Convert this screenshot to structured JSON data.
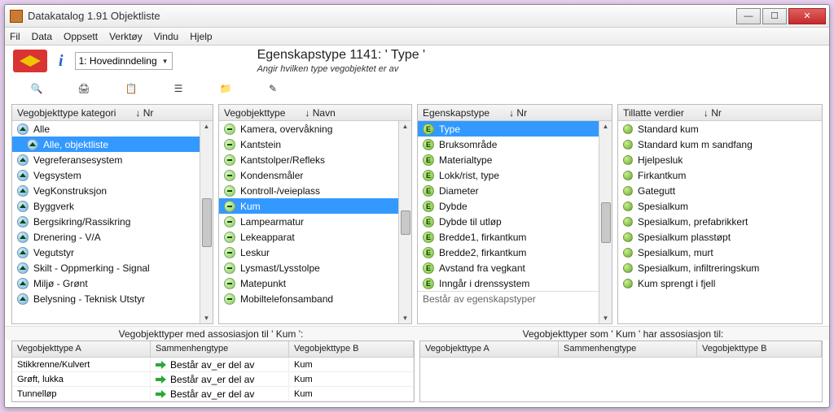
{
  "window": {
    "title": "Datakatalog 1.91  Objektliste"
  },
  "menubar": [
    "Fil",
    "Data",
    "Oppsett",
    "Verktøy",
    "Vindu",
    "Hjelp"
  ],
  "toolbar": {
    "combo_value": "1: Hovedinndeling",
    "title_big": "Egenskapstype 1141:  ' Type '",
    "title_small": "Angir hvilken type vegobjektet er av"
  },
  "panel1": {
    "header_label": "Vegobjekttype kategori",
    "header_sort": "↓ Nr",
    "items": [
      {
        "label": "Alle",
        "icon": "up",
        "selected": false
      },
      {
        "label": "Alle, objektliste",
        "icon": "up",
        "selected": true,
        "indent": true
      },
      {
        "label": "Vegreferansesystem",
        "icon": "up"
      },
      {
        "label": "Vegsystem",
        "icon": "up"
      },
      {
        "label": "VegKonstruksjon",
        "icon": "up"
      },
      {
        "label": "Byggverk",
        "icon": "up"
      },
      {
        "label": "Bergsikring/Rassikring",
        "icon": "up"
      },
      {
        "label": "Drenering - V/A",
        "icon": "up"
      },
      {
        "label": "Vegutstyr",
        "icon": "up"
      },
      {
        "label": "Skilt - Oppmerking - Signal",
        "icon": "up"
      },
      {
        "label": "Miljø - Grønt",
        "icon": "up"
      },
      {
        "label": "Belysning - Teknisk Utstyr",
        "icon": "up"
      }
    ]
  },
  "panel2": {
    "header_label": "Vegobjekttype",
    "header_sort": "↓ Navn",
    "items": [
      {
        "label": "Kamera, overvåkning",
        "icon": "minus"
      },
      {
        "label": "Kantstein",
        "icon": "minus"
      },
      {
        "label": "Kantstolper/Refleks",
        "icon": "minus"
      },
      {
        "label": "Kondensmåler",
        "icon": "minus"
      },
      {
        "label": "Kontroll-/veieplass",
        "icon": "minus"
      },
      {
        "label": "Kum",
        "icon": "minus",
        "selected": true
      },
      {
        "label": "Lampearmatur",
        "icon": "minus"
      },
      {
        "label": "Lekeapparat",
        "icon": "minus"
      },
      {
        "label": "Leskur",
        "icon": "minus"
      },
      {
        "label": "Lysmast/Lysstolpe",
        "icon": "minus"
      },
      {
        "label": "Matepunkt",
        "icon": "minus"
      },
      {
        "label": "Mobiltelefonsamband",
        "icon": "minus"
      }
    ]
  },
  "panel3": {
    "header_label": "Egenskapstype",
    "header_sort": "↓ Nr",
    "items": [
      {
        "label": "Type",
        "selected": true
      },
      {
        "label": "Bruksområde"
      },
      {
        "label": "Materialtype"
      },
      {
        "label": "Lokk/rist, type"
      },
      {
        "label": "Diameter"
      },
      {
        "label": "Dybde"
      },
      {
        "label": "Dybde til utløp"
      },
      {
        "label": "Bredde1, firkantkum"
      },
      {
        "label": "Bredde2, firkantkum"
      },
      {
        "label": "Avstand fra vegkant"
      },
      {
        "label": "Inngår i drenssystem"
      }
    ],
    "footer": "Består av egenskapstyper"
  },
  "panel4": {
    "header_label": "Tillatte verdier",
    "header_sort": "↓ Nr",
    "items": [
      {
        "label": "Standard kum"
      },
      {
        "label": "Standard kum m sandfang"
      },
      {
        "label": "Hjelpesluk"
      },
      {
        "label": "Firkantkum"
      },
      {
        "label": "Gategutt"
      },
      {
        "label": "Spesialkum"
      },
      {
        "label": "Spesialkum, prefabrikkert"
      },
      {
        "label": "Spesialkum plasstøpt"
      },
      {
        "label": "Spesialkum, murt"
      },
      {
        "label": "Spesialkum, infiltreringskum"
      },
      {
        "label": "Kum sprengt i fjell"
      }
    ]
  },
  "assoc": {
    "left_title": "Vegobjekttyper med assosiasjon til ' Kum ':",
    "right_title": "Vegobjekttyper som ' Kum ' har assosiasjon til:",
    "cols": [
      "Vegobjekttype A",
      "Sammenhengtype",
      "Vegobjekttype B"
    ],
    "left_rows": [
      {
        "a": "Stikkrenne/Kulvert",
        "s": "Består av_er del av",
        "b": "Kum"
      },
      {
        "a": "Grøft, lukka",
        "s": "Består av_er del av",
        "b": "Kum"
      },
      {
        "a": "Tunnelløp",
        "s": "Består av_er del av",
        "b": "Kum"
      }
    ]
  }
}
